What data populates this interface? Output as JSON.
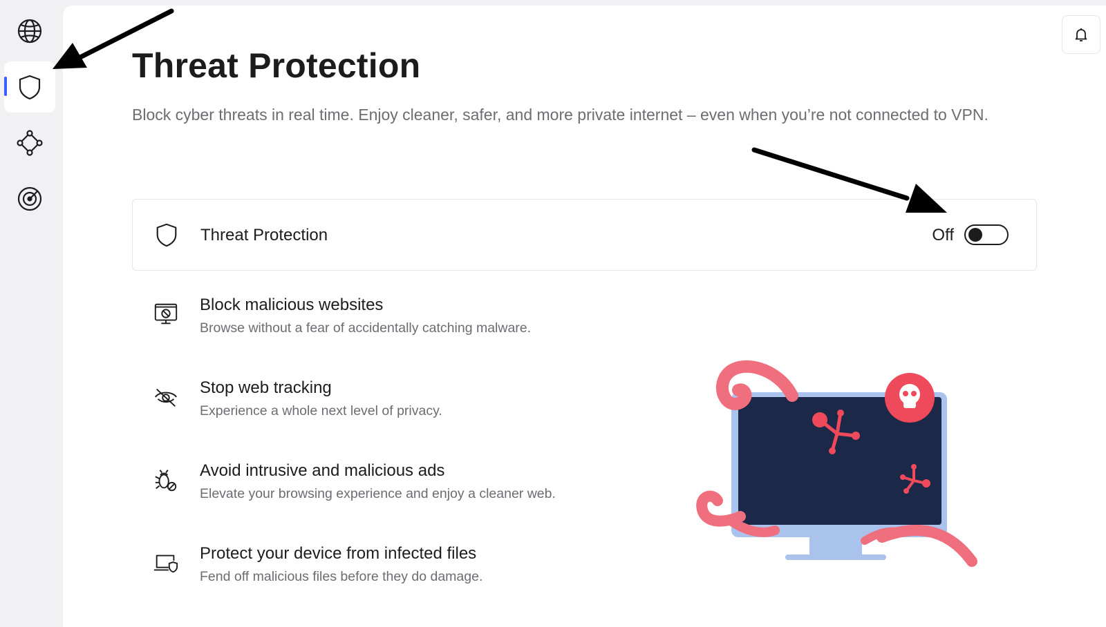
{
  "sidebar": {
    "items": [
      {
        "icon": "globe-icon"
      },
      {
        "icon": "shield-icon",
        "active": true
      },
      {
        "icon": "meshnet-icon"
      },
      {
        "icon": "dark-web-monitor-icon"
      }
    ],
    "accent_color": "#3e5fff"
  },
  "header": {
    "title": "Threat Protection",
    "description": "Block cyber threats in real time. Enjoy cleaner, safer, and more private internet – even when you’re not connected to VPN.",
    "notification_icon": "bell-icon"
  },
  "toggle_card": {
    "label": "Threat Protection",
    "state_label": "Off",
    "enabled": false,
    "icon": "shield-icon"
  },
  "features": [
    {
      "icon": "blocked-screen-icon",
      "title": "Block malicious websites",
      "subtitle": "Browse without a fear of accidentally catching malware."
    },
    {
      "icon": "eye-slash-icon",
      "title": "Stop web tracking",
      "subtitle": "Experience a whole next level of privacy."
    },
    {
      "icon": "bug-blocked-icon",
      "title": "Avoid intrusive and malicious ads",
      "subtitle": "Elevate your browsing experience and enjoy a cleaner web."
    },
    {
      "icon": "laptop-shield-icon",
      "title": "Protect your device from infected files",
      "subtitle": "Fend off malicious files before they do damage."
    }
  ],
  "colors": {
    "threat_red": "#ef4a5c",
    "screen_navy": "#1b2848",
    "monitor_frame": "#a9c3ec"
  }
}
